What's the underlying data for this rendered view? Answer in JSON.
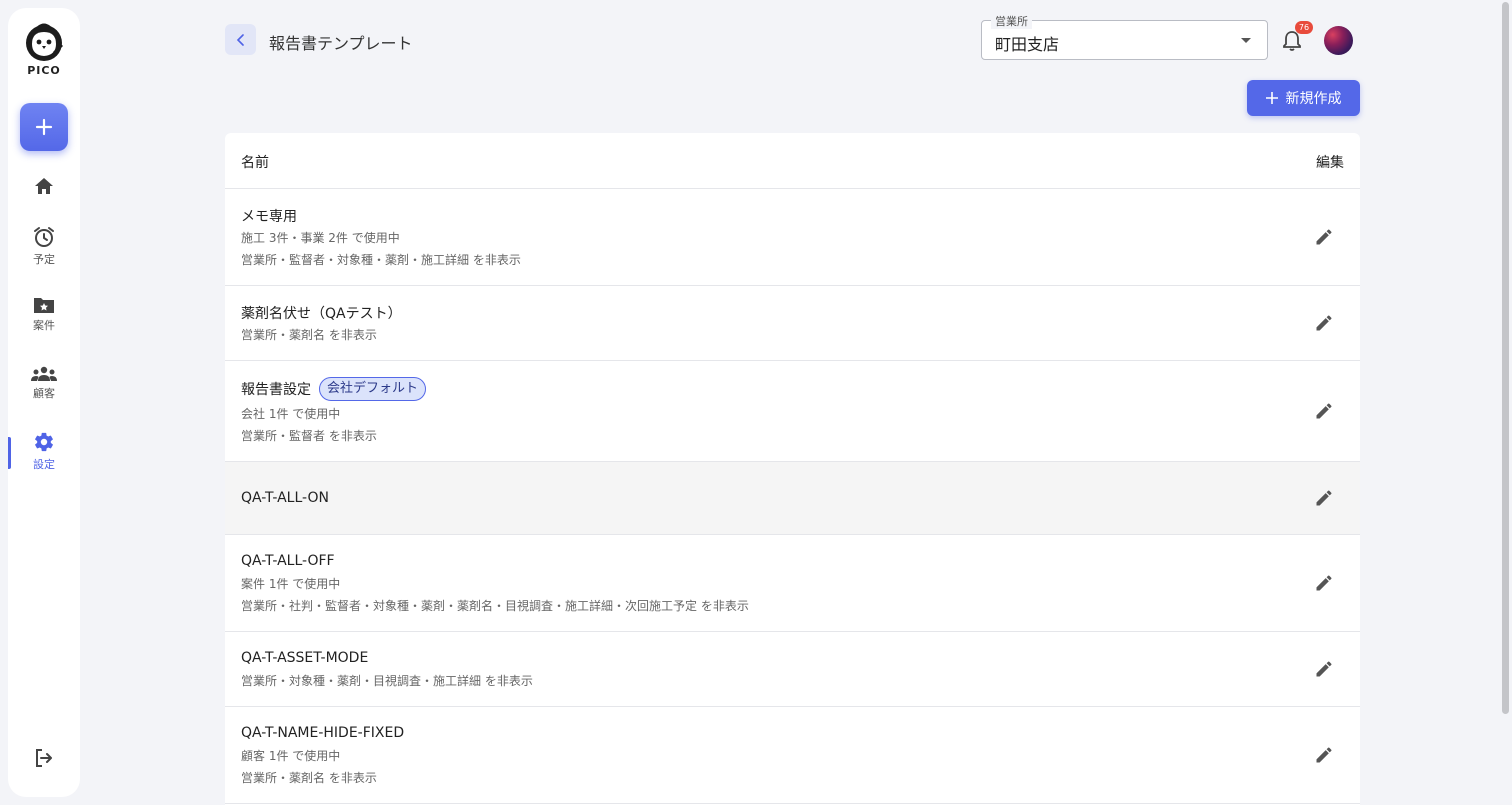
{
  "sidebar": {
    "logo_text": "PICO",
    "nav": [
      {
        "name": "home",
        "label": ""
      },
      {
        "name": "schedule",
        "label": "予定"
      },
      {
        "name": "cases",
        "label": "案件"
      },
      {
        "name": "customers",
        "label": "顧客"
      },
      {
        "name": "settings",
        "label": "設定",
        "active": true
      }
    ]
  },
  "header": {
    "title": "報告書テンプレート",
    "office_label": "営業所",
    "office_value": "町田支店",
    "notification_count": "76",
    "new_button_label": "新規作成"
  },
  "table": {
    "col_name": "名前",
    "col_edit": "編集",
    "rows": [
      {
        "name": "メモ専用",
        "chip": "",
        "lines": [
          "施工 3件・事業 2件 で使用中",
          "営業所・監督者・対象種・薬剤・施工詳細 を非表示"
        ]
      },
      {
        "name": "薬剤名伏せ（QAテスト）",
        "chip": "",
        "lines": [
          "営業所・薬剤名 を非表示"
        ]
      },
      {
        "name": "報告書設定",
        "chip": "会社デフォルト",
        "lines": [
          "会社 1件 で使用中",
          "営業所・監督者 を非表示"
        ]
      },
      {
        "name": "QA-T-ALL-ON",
        "chip": "",
        "lines": []
      },
      {
        "name": "QA-T-ALL-OFF",
        "chip": "",
        "lines": [
          "案件 1件 で使用中",
          "営業所・社判・監督者・対象種・薬剤・薬剤名・目視調査・施工詳細・次回施工予定 を非表示"
        ]
      },
      {
        "name": "QA-T-ASSET-MODE",
        "chip": "",
        "lines": [
          "営業所・対象種・薬剤・目視調査・施工詳細 を非表示"
        ]
      },
      {
        "name": "QA-T-NAME-HIDE-FIXED",
        "chip": "",
        "lines": [
          "顧客 1件 で使用中",
          "営業所・薬剤名 を非表示"
        ]
      }
    ]
  },
  "colors": {
    "accent": "#5468e8",
    "badge": "#e84b3c",
    "chip_bg": "#dbe3fb"
  }
}
